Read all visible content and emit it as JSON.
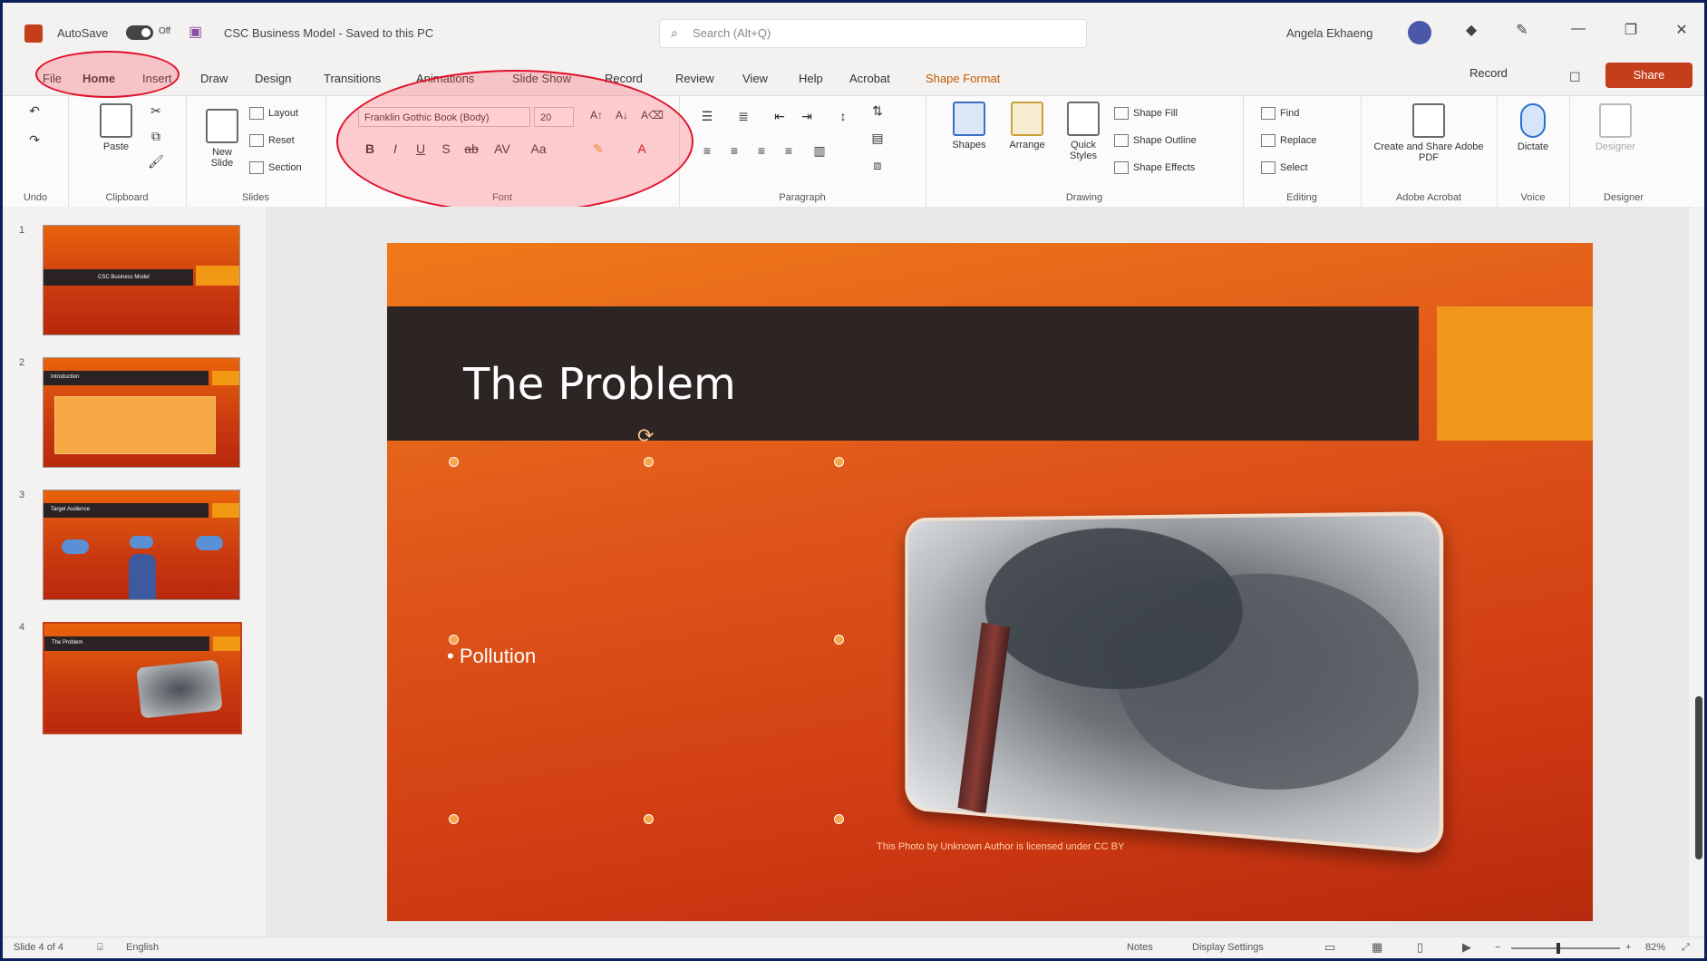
{
  "titlebar": {
    "autosave_label": "AutoSave",
    "autosave_state": "Off",
    "doc_title": "CSC Business Model - Saved to this PC",
    "search_placeholder": "Search (Alt+Q)",
    "user_name": "Angela Ekhaeng",
    "icons": [
      "app-icon",
      "save-icon",
      "undo-icon",
      "search-icon",
      "diamond-icon",
      "pen-icon",
      "minimize-icon",
      "maximize-icon",
      "close-icon"
    ]
  },
  "menu": {
    "tabs": [
      {
        "label": "File"
      },
      {
        "label": "Home"
      },
      {
        "label": "Insert"
      },
      {
        "label": "Draw"
      },
      {
        "label": "Design"
      },
      {
        "label": "Transitions"
      },
      {
        "label": "Animations"
      },
      {
        "label": "Slide Show"
      },
      {
        "label": "Record"
      },
      {
        "label": "Review"
      },
      {
        "label": "View"
      },
      {
        "label": "Help"
      },
      {
        "label": "Acrobat"
      },
      {
        "label": "Shape Format"
      }
    ],
    "record_label": "Record",
    "share_label": "Share"
  },
  "ribbon": {
    "groups": {
      "undo": "Undo",
      "clipboard": "Clipboard",
      "slides": "Slides",
      "font": "Font",
      "paragraph": "Paragraph",
      "drawing": "Drawing",
      "editing": "Editing",
      "adobe": "Adobe Acrobat",
      "voice": "Voice",
      "designer": "Designer"
    },
    "paste_label": "Paste",
    "new_slide_label": "New Slide",
    "layout_label": "Layout",
    "reset_label": "Reset",
    "section_label": "Section",
    "font_name": "Franklin Gothic Book (Body)",
    "font_size": "20",
    "shapes_label": "Shapes",
    "arrange_label": "Arrange",
    "quick_styles_label": "Quick Styles",
    "shape_fill_label": "Shape Fill",
    "shape_outline_label": "Shape Outline",
    "shape_effects_label": "Shape Effects",
    "find_label": "Find",
    "replace_label": "Replace",
    "select_label": "Select",
    "adobe_label": "Create and Share Adobe PDF",
    "dictate_label": "Dictate",
    "designer_label": "Designer"
  },
  "thumbnails": [
    {
      "num": "1",
      "title": "CSC Business Model"
    },
    {
      "num": "2",
      "title": "Introduction"
    },
    {
      "num": "3",
      "title": "Target Audience"
    },
    {
      "num": "4",
      "title": "The Problem"
    }
  ],
  "slide": {
    "title": "The Problem",
    "bullet": "• Pollution",
    "caption": "This Photo by Unknown Author is licensed under CC BY"
  },
  "status": {
    "slide_of": "Slide 4 of 4",
    "language": "English",
    "notes_label": "Notes",
    "display_settings_label": "Display Settings",
    "zoom": "82%"
  },
  "colors": {
    "brand": "#c43e1c",
    "slide_orange": "#e0581a",
    "slide_dark": "#2d2524",
    "slide_accent": "#f2961b",
    "annotation": "#e0102a"
  }
}
